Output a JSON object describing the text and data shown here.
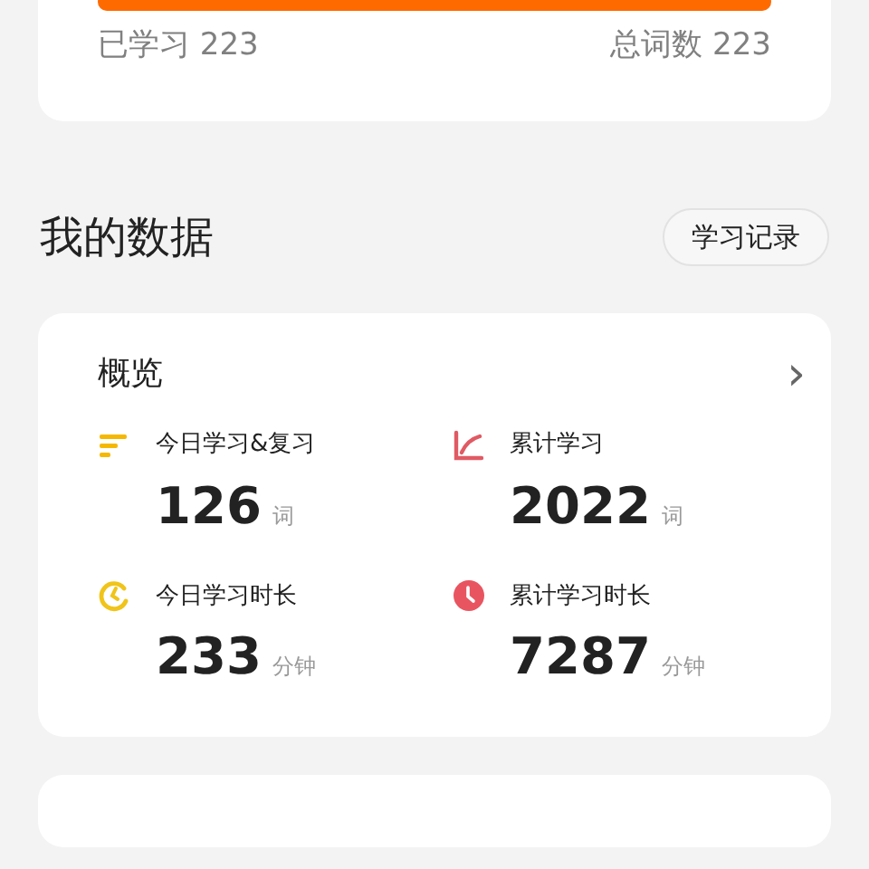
{
  "progress": {
    "level": 1,
    "learned": "已学习 223",
    "total": "总词数 223"
  },
  "section": {
    "title": "我的数据",
    "button": "学习记录"
  },
  "overview": {
    "title": "概览",
    "chevron": "›",
    "stats": [
      {
        "kind": "bars",
        "color": "#f5b800",
        "label": "今日学习&复习",
        "value": "126",
        "unit": "词"
      },
      {
        "kind": "trend",
        "color": "#e05a63",
        "label": "累计学习",
        "value": "2022",
        "unit": "词"
      },
      {
        "kind": "timer",
        "color": "#f0c419",
        "label": "今日学习时长",
        "value": "233",
        "unit": "分钟"
      },
      {
        "kind": "clock",
        "color": "#e85560",
        "label": "累计学习时长",
        "value": "7287",
        "unit": "分钟"
      }
    ]
  }
}
